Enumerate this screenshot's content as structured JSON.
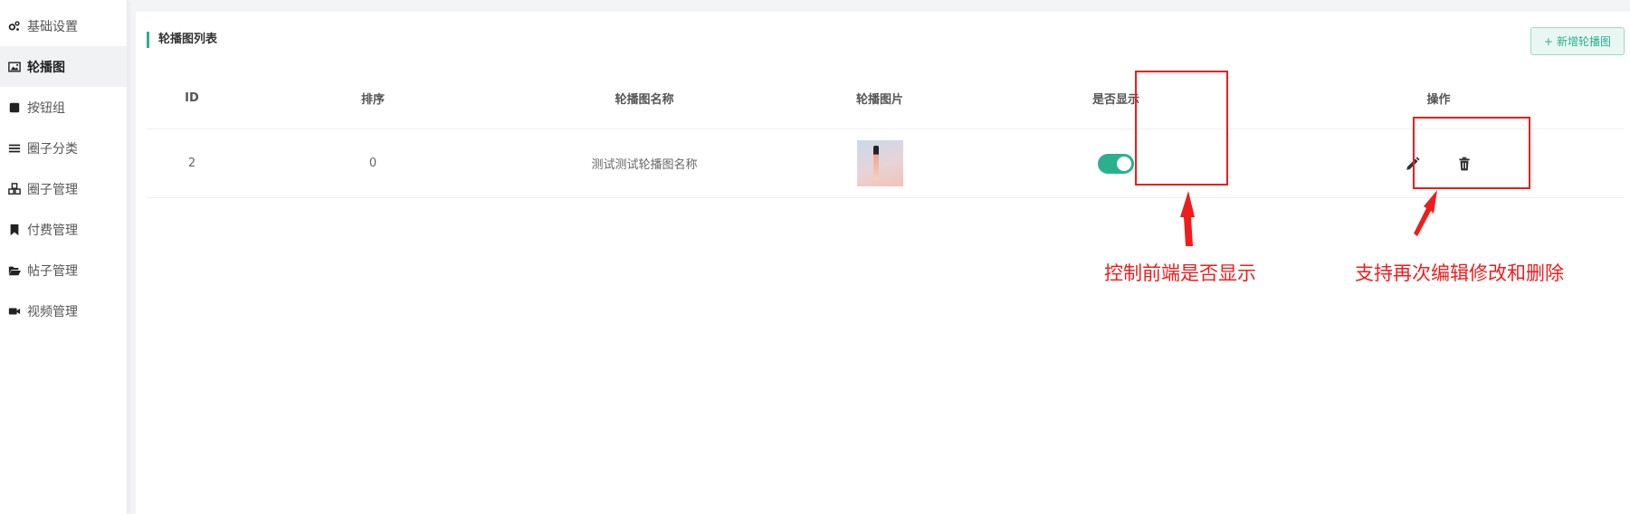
{
  "sidebar": {
    "items": [
      {
        "label": "基础设置",
        "icon": "gears-icon",
        "active": false
      },
      {
        "label": "轮播图",
        "icon": "image-icon",
        "active": true
      },
      {
        "label": "按钮组",
        "icon": "square-icon",
        "active": false
      },
      {
        "label": "圈子分类",
        "icon": "list-icon",
        "active": false
      },
      {
        "label": "圈子管理",
        "icon": "cubes-icon",
        "active": false
      },
      {
        "label": "付费管理",
        "icon": "bookmark-icon",
        "active": false
      },
      {
        "label": "帖子管理",
        "icon": "folder-open-icon",
        "active": false
      },
      {
        "label": "视频管理",
        "icon": "video-camera-icon",
        "active": false
      }
    ]
  },
  "panel": {
    "title": "轮播图列表",
    "add_button_icon": "+",
    "add_button_label": "新增轮播图"
  },
  "table": {
    "headers": [
      "ID",
      "排序",
      "轮播图名称",
      "轮播图片",
      "是否显示",
      "操作"
    ],
    "rows": [
      {
        "id": "2",
        "sort": "0",
        "name": "测试测试轮播图名称",
        "image": "thumbnail",
        "visible": true
      }
    ]
  },
  "annotations": {
    "toggle_note": "控制前端是否显示",
    "ops_note": "支持再次编辑修改和删除"
  },
  "colors": {
    "accent": "#2bb08f",
    "annotation": "#f01c1c"
  }
}
